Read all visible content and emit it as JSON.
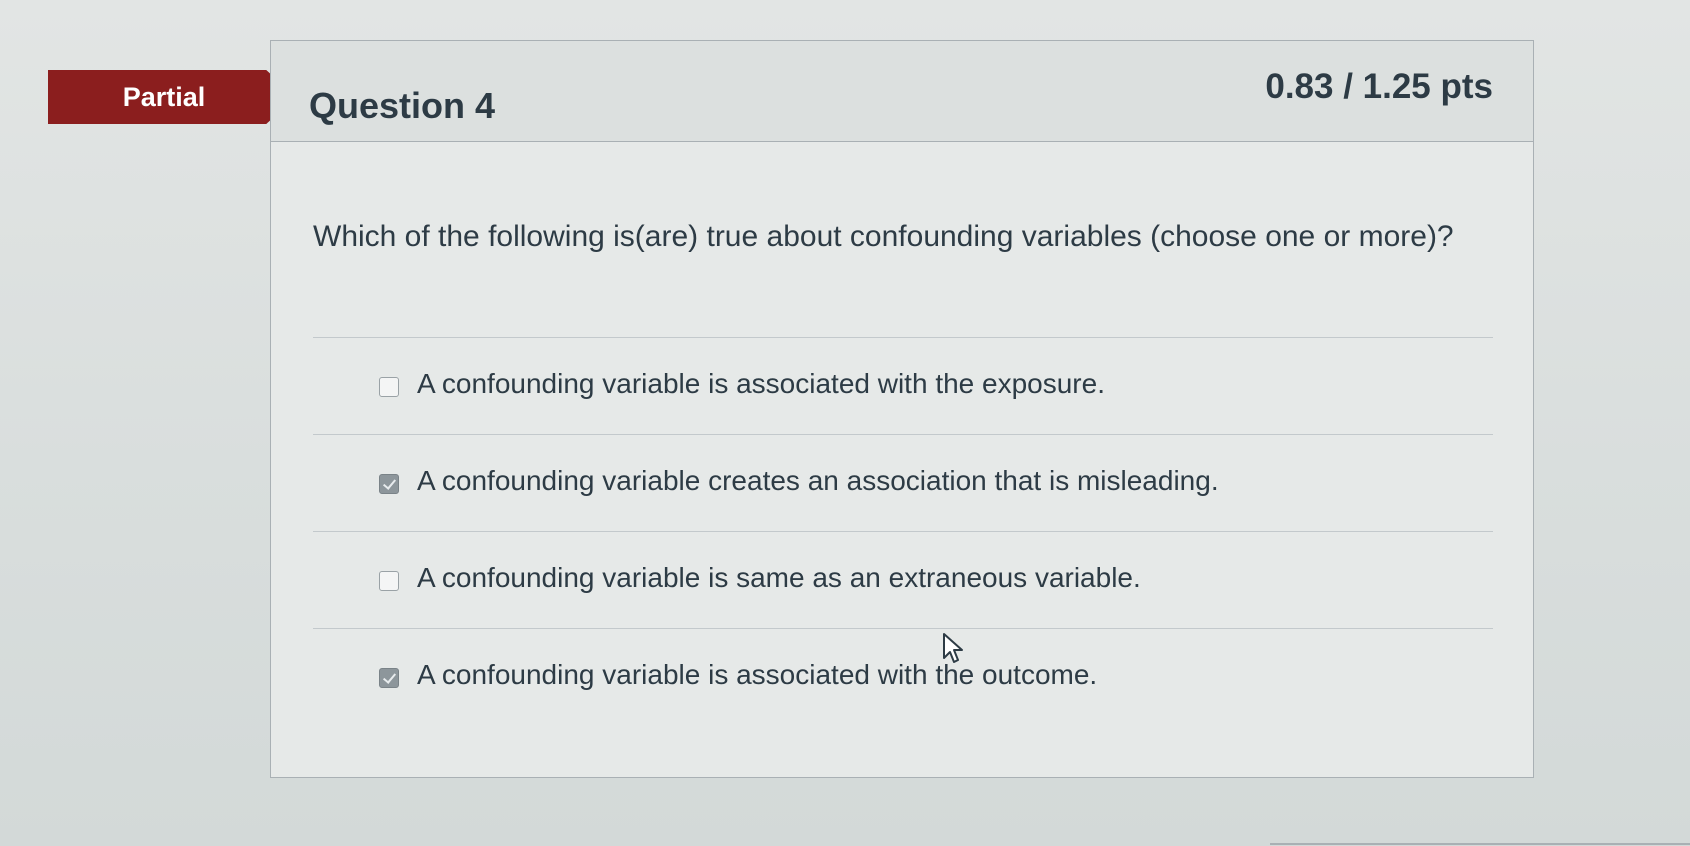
{
  "status": {
    "label": "Partial",
    "color": "#8b1e1e"
  },
  "question": {
    "title": "Question 4",
    "points": "0.83 / 1.25 pts",
    "text": "Which of the following is(are) true about confounding variables (choose one or more)?"
  },
  "answers": [
    {
      "label": "A confounding variable is associated with the exposure.",
      "checked": false
    },
    {
      "label": "A confounding variable creates an association that is misleading.",
      "checked": true
    },
    {
      "label": "A confounding variable is same as an extraneous variable.",
      "checked": false
    },
    {
      "label": "A confounding variable is associated with the outcome.",
      "checked": true
    }
  ],
  "icons": {
    "cursor": "mouse-pointer-icon"
  }
}
